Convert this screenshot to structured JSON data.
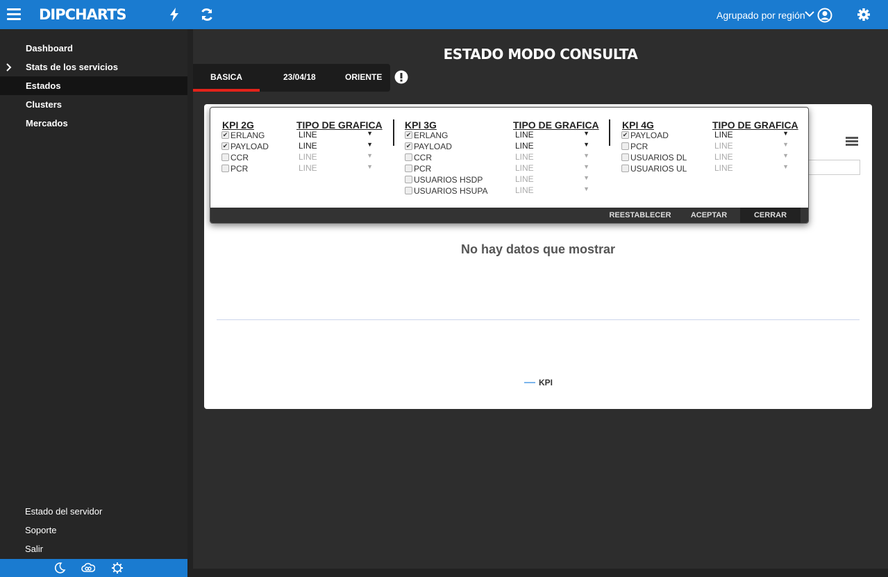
{
  "topbar": {
    "brand": "DIPCHARTS",
    "group_label": "Agrupado por región",
    "colors": {
      "bar": "#1a7bd0"
    }
  },
  "sidebar": {
    "items": [
      {
        "label": "Dashboard"
      },
      {
        "label": "Stats de los servicios",
        "expandable": true
      },
      {
        "label": "Estados",
        "active": true
      },
      {
        "label": "Clusters"
      },
      {
        "label": "Mercados"
      }
    ],
    "footer_links": [
      {
        "label": "Estado del servidor"
      },
      {
        "label": "Soporte"
      },
      {
        "label": "Salir"
      }
    ],
    "footer_icons": [
      "moon-icon",
      "cloud-link-icon",
      "gear-icon"
    ]
  },
  "main": {
    "title": "ESTADO MODO CONSULTA",
    "tabs": [
      {
        "label": "BASICA",
        "active": true
      },
      {
        "label": "23/04/18"
      },
      {
        "label": "ORIENTE"
      }
    ],
    "no_data": "No hay datos que mostrar",
    "legend": "KPI"
  },
  "popup": {
    "chart_type_header": "TIPO DE GRAFICA",
    "groups": [
      {
        "title": "KPI 2G",
        "items": [
          {
            "label": "ERLANG",
            "checked": true,
            "type": "LINE"
          },
          {
            "label": "PAYLOAD",
            "checked": true,
            "type": "LINE"
          },
          {
            "label": "CCR",
            "checked": false,
            "type": "LINE"
          },
          {
            "label": "PCR",
            "checked": false,
            "type": "LINE"
          }
        ]
      },
      {
        "title": "KPI 3G",
        "items": [
          {
            "label": "ERLANG",
            "checked": true,
            "type": "LINE"
          },
          {
            "label": "PAYLOAD",
            "checked": true,
            "type": "LINE"
          },
          {
            "label": "CCR",
            "checked": false,
            "type": "LINE"
          },
          {
            "label": "PCR",
            "checked": false,
            "type": "LINE"
          },
          {
            "label": "USUARIOS HSDP",
            "checked": false,
            "type": "LINE"
          },
          {
            "label": "USUARIOS HSUPA",
            "checked": false,
            "type": "LINE"
          }
        ]
      },
      {
        "title": "KPI 4G",
        "items": [
          {
            "label": "PAYLOAD",
            "checked": true,
            "type": "LINE"
          },
          {
            "label": "PCR",
            "checked": false,
            "type": "LINE"
          },
          {
            "label": "USUARIOS DL",
            "checked": false,
            "type": "LINE"
          },
          {
            "label": "USUARIOS UL",
            "checked": false,
            "type": "LINE"
          }
        ]
      }
    ],
    "buttons": {
      "reset": "REESTABLECER",
      "accept": "ACEPTAR",
      "close": "CERRAR"
    }
  }
}
